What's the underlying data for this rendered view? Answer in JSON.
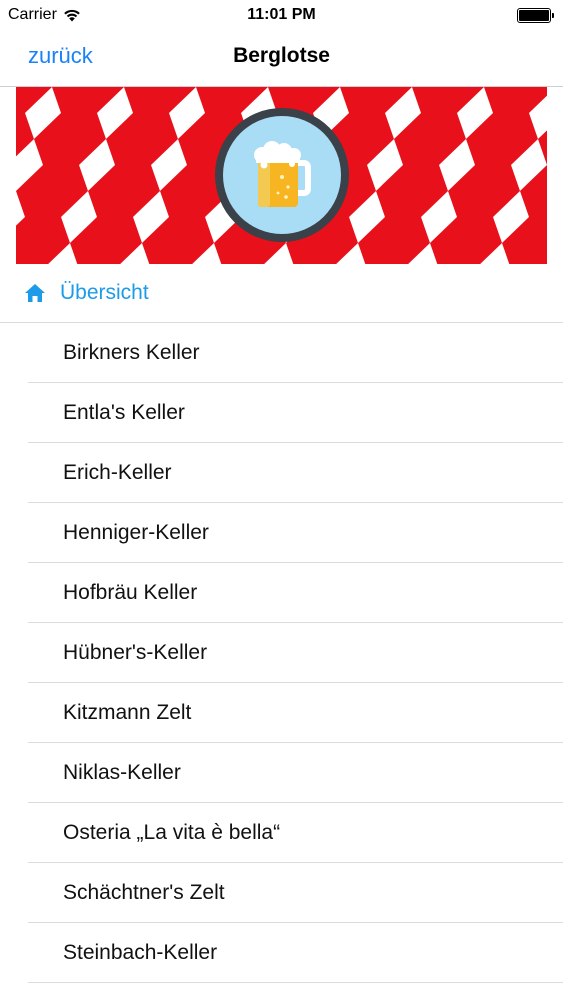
{
  "status_bar": {
    "carrier": "Carrier",
    "time": "11:01 PM",
    "battery_level": 1.0
  },
  "nav": {
    "back_label": "zurück",
    "title": "Berglotse"
  },
  "banner": {
    "pattern_colors": [
      "#e8101a",
      "#ffffff"
    ],
    "logo_icon": "beer-mug-icon"
  },
  "menu": {
    "header": {
      "label": "Übersicht",
      "icon": "home-icon",
      "color": "#1e9be8"
    },
    "items": [
      {
        "label": "Birkners Keller"
      },
      {
        "label": "Entla's Keller"
      },
      {
        "label": "Erich-Keller"
      },
      {
        "label": "Henniger-Keller"
      },
      {
        "label": "Hofbräu Keller"
      },
      {
        "label": "Hübner's-Keller"
      },
      {
        "label": "Kitzmann Zelt"
      },
      {
        "label": "Niklas-Keller"
      },
      {
        "label": "Osteria „La vita è bella“"
      },
      {
        "label": "Schächtner's Zelt"
      },
      {
        "label": "Steinbach-Keller"
      }
    ]
  }
}
